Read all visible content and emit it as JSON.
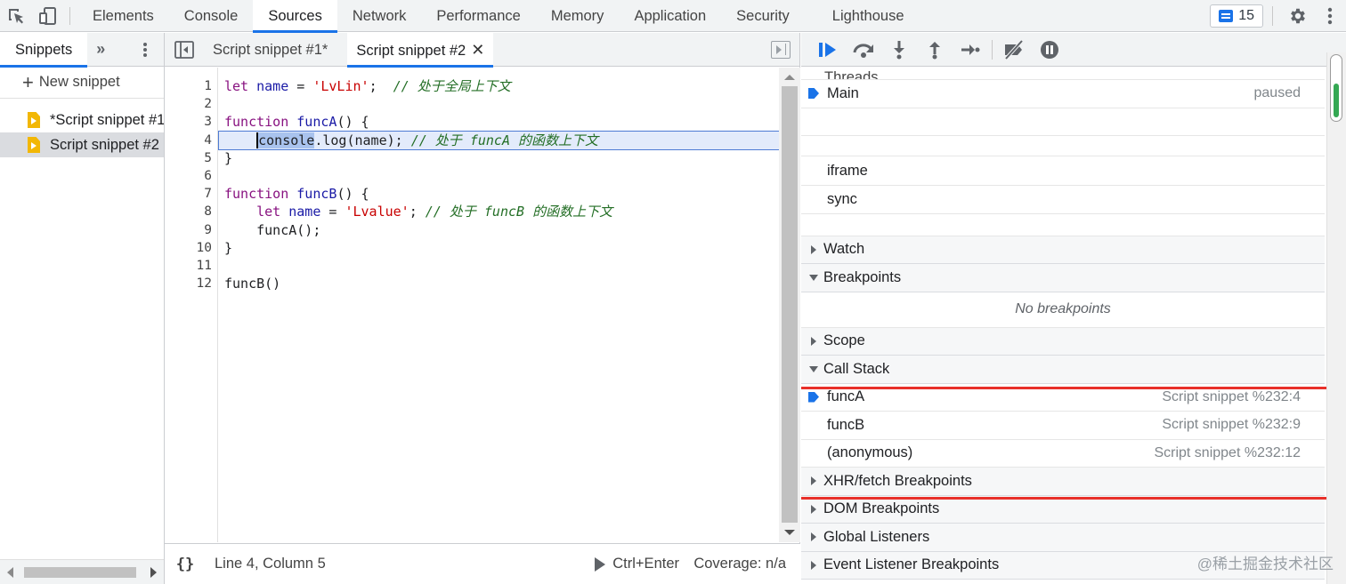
{
  "topbar": {
    "tabs": [
      "Elements",
      "Console",
      "Sources",
      "Network",
      "Performance",
      "Memory",
      "Application",
      "Security",
      "Lighthouse"
    ],
    "active_tab": "Sources",
    "issues_count": "15"
  },
  "navigator": {
    "tab_label": "Snippets",
    "more_label": "»",
    "new_snippet_label": "New snippet",
    "snippets": [
      "*Script snippet #1",
      "Script snippet #2"
    ]
  },
  "editor": {
    "tabs": [
      "Script snippet #1*",
      "Script snippet #2"
    ],
    "active_tab": "Script snippet #2",
    "line_numbers": [
      "1",
      "2",
      "3",
      "4",
      "5",
      "6",
      "7",
      "8",
      "9",
      "10",
      "11",
      "12"
    ],
    "current_line": 4,
    "status": {
      "pretty_print": "{}",
      "position": "Line 4, Column 5",
      "run_shortcut": "Ctrl+Enter",
      "coverage": "Coverage: n/a"
    }
  },
  "code": {
    "l1": {
      "kw": "let",
      "var": "name",
      "op": " = ",
      "str": "'LvLin'",
      "end": ";  ",
      "cm": "// 处于全局上下文"
    },
    "l3": {
      "kw": "function",
      "fn": "funcA",
      "rest": "() {"
    },
    "l4": {
      "indent": "    ",
      "sel": "console",
      "rest": ".log(name); ",
      "cm": "// 处于 funcA 的函数上下文"
    },
    "l5": {
      "text": "}"
    },
    "l7": {
      "kw": "function",
      "fn": "funcB",
      "rest": "() {"
    },
    "l8": {
      "indent": "    ",
      "kw": "let",
      "var": "name",
      "op": " = ",
      "str": "'Lvalue'",
      "end": "; ",
      "cm": "// 处于 funcB 的函数上下文"
    },
    "l9": {
      "text": "    funcA();"
    },
    "l10": {
      "text": "}"
    },
    "l12": {
      "text": "funcB()"
    }
  },
  "debugger": {
    "threads_label": "Threads",
    "main_thread": {
      "name": "Main",
      "state": "paused"
    },
    "contexts": [
      "iframe",
      "sync"
    ],
    "sections": {
      "watch": "Watch",
      "breakpoints": "Breakpoints",
      "no_breakpoints": "No breakpoints",
      "scope": "Scope",
      "call_stack": "Call Stack",
      "xhr": "XHR/fetch Breakpoints",
      "dom": "DOM Breakpoints",
      "global": "Global Listeners",
      "event": "Event Listener Breakpoints"
    },
    "call_stack": [
      {
        "name": "funcA",
        "location": "Script snippet %232:4",
        "current": true
      },
      {
        "name": "funcB",
        "location": "Script snippet %232:9",
        "current": false
      },
      {
        "name": "(anonymous)",
        "location": "Script snippet %232:12",
        "current": false
      }
    ]
  },
  "watermark": "@稀土掘金技术社区",
  "colors": {
    "accent": "#1a73e8",
    "highlight": "#e8302a",
    "file_icon": "#f2b705"
  }
}
